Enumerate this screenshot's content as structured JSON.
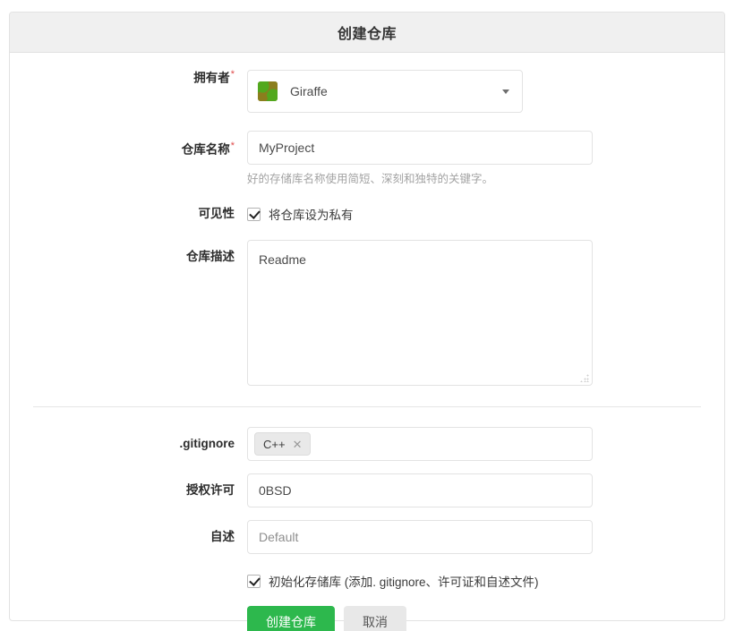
{
  "card": {
    "title": "创建仓库"
  },
  "form": {
    "owner": {
      "label": "拥有者",
      "required_mark": "*",
      "value": "Giraffe"
    },
    "repo_name": {
      "label": "仓库名称",
      "required_mark": "*",
      "value": "MyProject",
      "help": "好的存储库名称使用简短、深刻和独特的关键字。"
    },
    "visibility": {
      "label": "可见性",
      "checkbox_label": "将仓库设为私有",
      "checked": true
    },
    "description": {
      "label": "仓库描述",
      "value": "Readme"
    },
    "gitignore": {
      "label": ".gitignore",
      "tags": [
        {
          "name": "C++",
          "remove": "✕"
        }
      ]
    },
    "license": {
      "label": "授权许可",
      "value": "0BSD"
    },
    "readme": {
      "label": "自述",
      "value": "Default"
    },
    "initialize": {
      "checkbox_label": "初始化存储库 (添加. gitignore、许可证和自述文件)",
      "checked": true
    },
    "actions": {
      "submit_label": "创建仓库",
      "cancel_label": "取消"
    }
  },
  "colors": {
    "primary_button": "#2db84d",
    "secondary_button": "#e8e8e8",
    "header_bg": "#f0f0f0",
    "border": "#e2e2e2",
    "required_asterisk": "#e04c4c",
    "help_text": "#a3a3a3"
  }
}
